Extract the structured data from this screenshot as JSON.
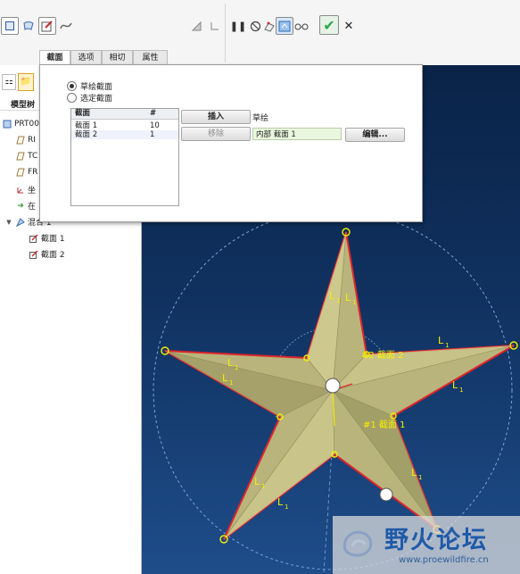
{
  "toolbar": {
    "confirm_glyph": "✔",
    "cancel_glyph": "✕",
    "pause_glyph": "❚❚"
  },
  "dashboard_tabs": [
    "截面",
    "选项",
    "相切",
    "属性"
  ],
  "model_tree": {
    "tab_label": "模型树",
    "items": [
      {
        "label": "PRT00",
        "icon": "part-icon"
      },
      {
        "label": "RI",
        "icon": "datum-plane-icon"
      },
      {
        "label": "TC",
        "icon": "datum-plane-icon"
      },
      {
        "label": "FR",
        "icon": "datum-plane-icon"
      },
      {
        "label": "坐",
        "icon": "csys-icon"
      },
      {
        "label": "在",
        "icon": "insert-here-icon"
      },
      {
        "label": "混合 1",
        "icon": "blend-feature-icon"
      },
      {
        "label": "截面 1",
        "icon": "sketch-icon"
      },
      {
        "label": "截面 2",
        "icon": "sketch-icon"
      }
    ]
  },
  "section_panel": {
    "radio_sketched": "草绘截面",
    "radio_selected": "选定截面",
    "table": {
      "headers": [
        "截面",
        "#"
      ],
      "rows": [
        {
          "name": "截面 1",
          "count": "10"
        },
        {
          "name": "截面 2",
          "count": "1"
        }
      ]
    },
    "insert_label": "插入",
    "insert_note": "草绘",
    "remove_label": "移除",
    "location_value": "内部 截面 1",
    "edit_label": "编辑..."
  },
  "graphics": {
    "labels": {
      "section2": "#2 截面 2",
      "section1": "#1 截面 1",
      "L": "L",
      "sub": "1"
    }
  },
  "watermark": {
    "title": "野火论坛",
    "url": "www.proewildfire.cn"
  },
  "colors": {
    "canvas_top": "#0a2348",
    "canvas_bottom": "#1e4d8a",
    "star_fill": "#b7b37a",
    "star_edge": "#e0242a",
    "label_yellow": "#f4f000",
    "confirm_green": "#2aa84a"
  }
}
